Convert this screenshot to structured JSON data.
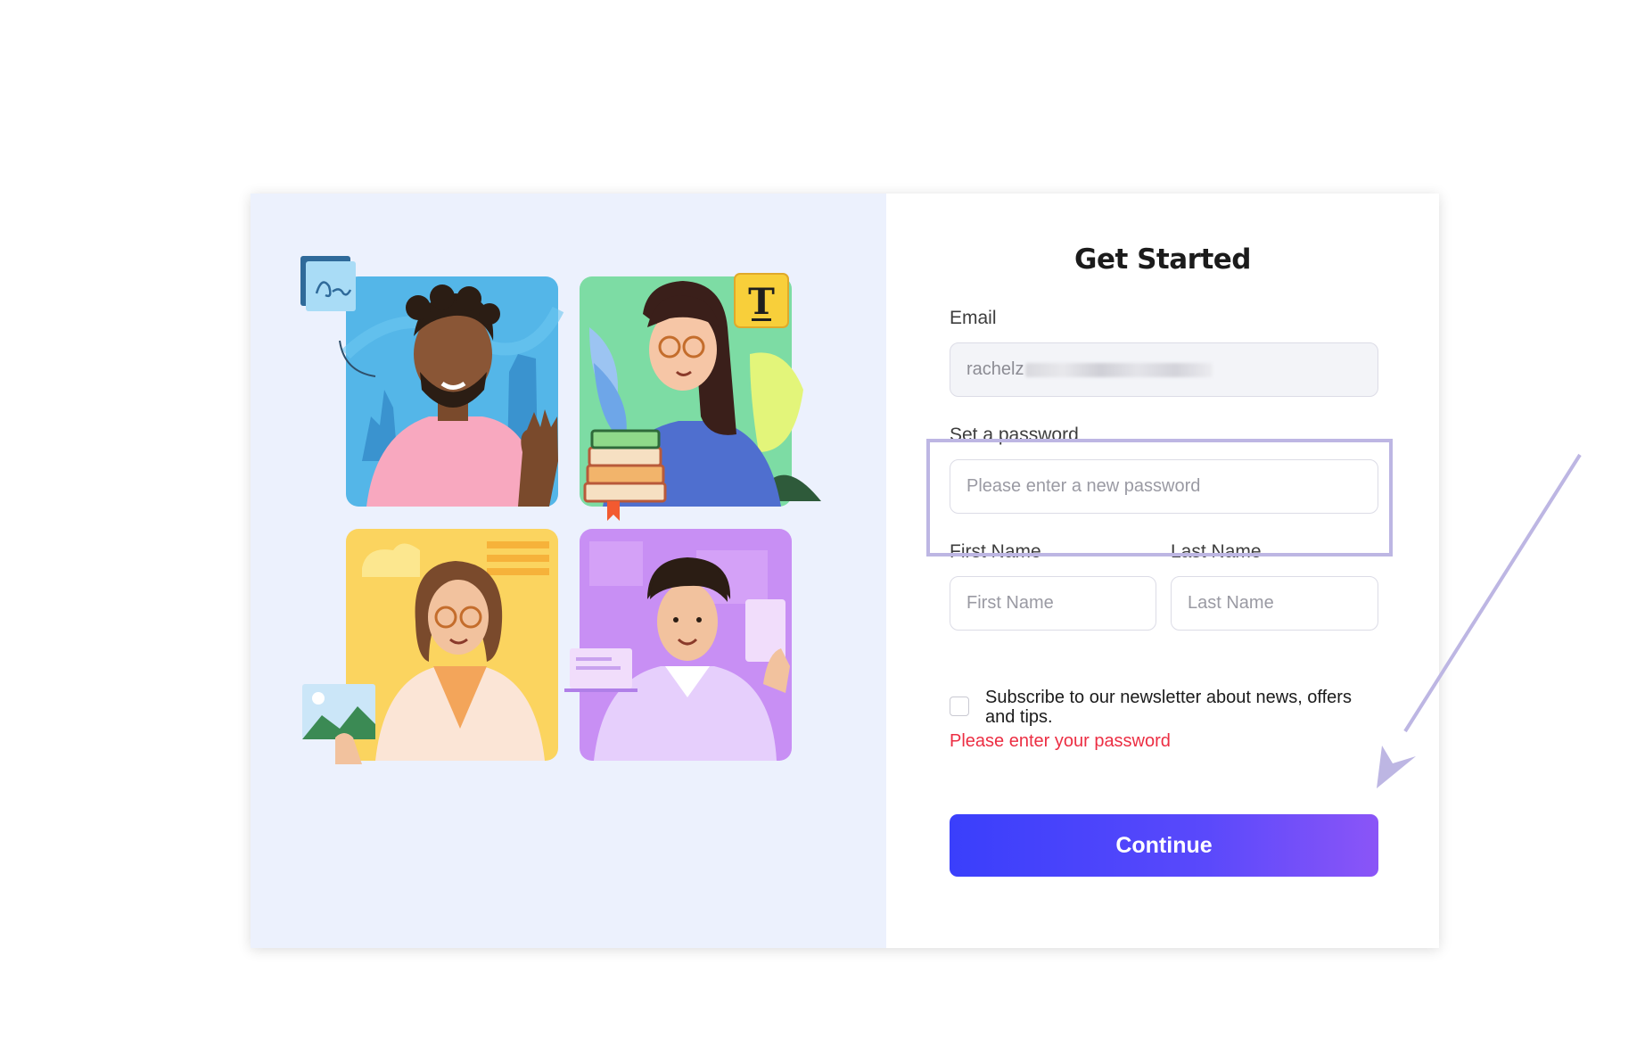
{
  "form": {
    "title": "Get Started",
    "email_label": "Email",
    "email_value": "rachelz",
    "password_label": "Set a password",
    "password_placeholder": "Please enter a new password",
    "first_name_label": "First Name",
    "first_name_placeholder": "First Name",
    "last_name_label": "Last Name",
    "last_name_placeholder": "Last Name",
    "newsletter_text": "Subscribe to our newsletter about news, offers and tips.",
    "error_text": "Please enter your password",
    "continue_label": "Continue"
  },
  "illustration": {
    "text_tool_glyph": "T",
    "signature_glyph": "Ɑa",
    "icons": [
      "signature-icon",
      "text-tool-icon",
      "image-card-icon",
      "bookmark-icon"
    ]
  },
  "colors": {
    "left_panel_bg": "#ecf1fd",
    "accent_start": "#3a3ffb",
    "accent_end": "#8b55f7",
    "error": "#ec2e43",
    "annotation": "#bdb6e3"
  }
}
